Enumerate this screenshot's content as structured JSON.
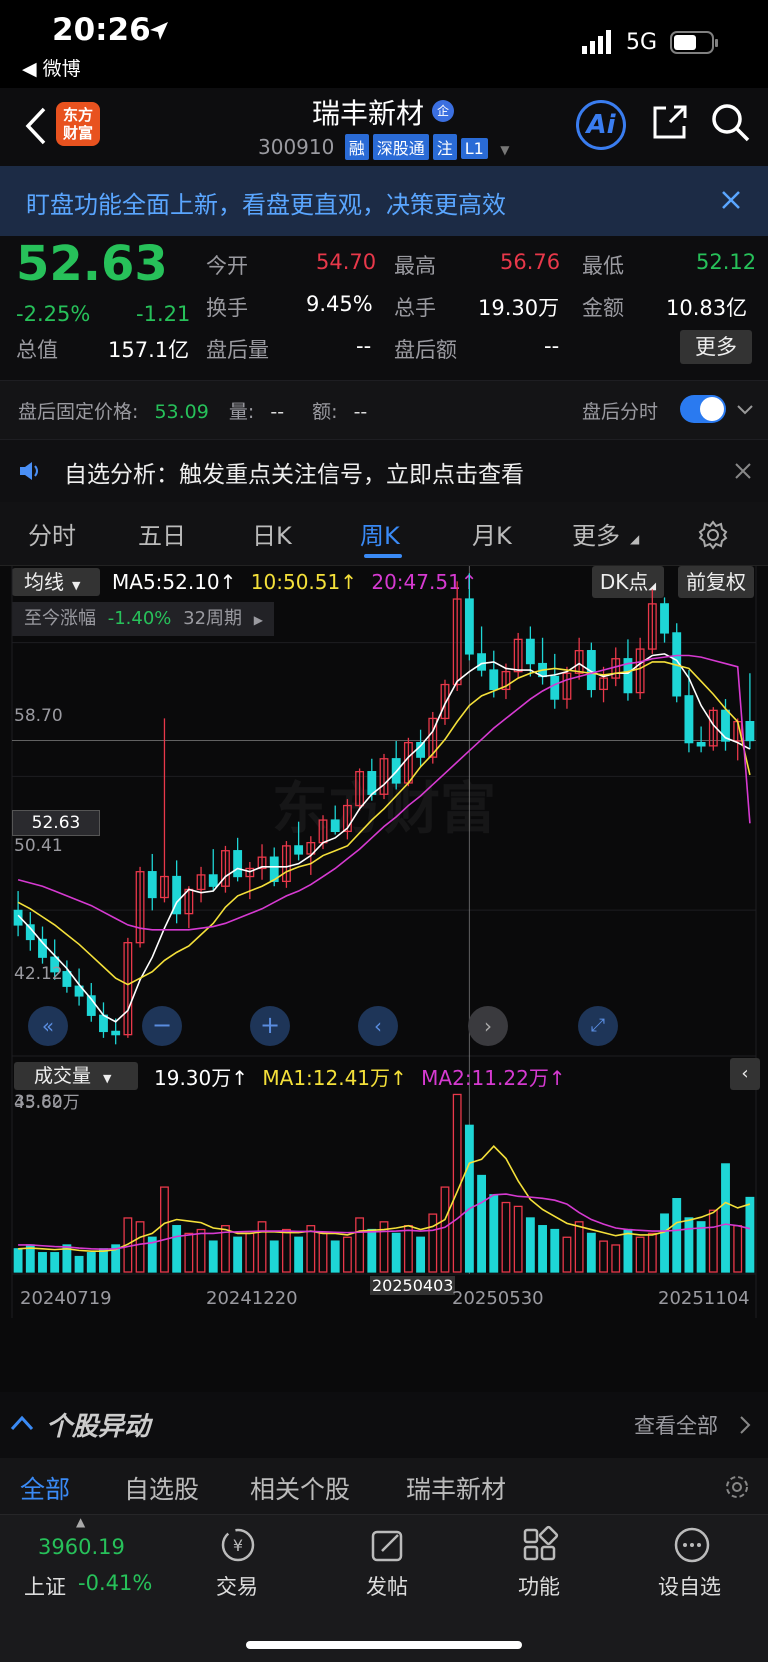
{
  "status_bar": {
    "time": "20:26",
    "back_app": "◀ 微博",
    "network": "5G"
  },
  "nav": {
    "stock_name": "瑞丰新材",
    "code": "300910",
    "badges": [
      "融",
      "深股通",
      "注",
      "L1"
    ],
    "logo_line1": "东方",
    "logo_line2": "财富",
    "ai_label": "Ai"
  },
  "banner": {
    "text": "盯盘功能全面上新，看盘更直观，决策更高效"
  },
  "quote": {
    "price": "52.63",
    "change_pct": "-2.25%",
    "change": "-1.21",
    "open_label": "今开",
    "open": "54.70",
    "high_label": "最高",
    "high": "56.76",
    "low_label": "最低",
    "low": "52.12",
    "turnover_label": "换手",
    "turnover": "9.45%",
    "volume_label": "总手",
    "volume": "19.30万",
    "amount_label": "金额",
    "amount": "10.83亿",
    "mktcap_label": "总值",
    "mktcap": "157.1亿",
    "after_vol_label": "盘后量",
    "after_vol": "--",
    "after_amt_label": "盘后额",
    "after_amt": "--",
    "more": "更多"
  },
  "after_hours": {
    "label": "盘后固定价格:",
    "price": "53.09",
    "vol_label": "量:",
    "vol": "--",
    "amt_label": "额:",
    "amt": "--",
    "toggle_label": "盘后分时"
  },
  "notice": {
    "text": "自选分析：触发重点关注信号，立即点击查看"
  },
  "tabs": [
    {
      "label": "分时"
    },
    {
      "label": "五日"
    },
    {
      "label": "日K"
    },
    {
      "label": "周K",
      "active": true
    },
    {
      "label": "月K"
    },
    {
      "label": "更多"
    }
  ],
  "chart_header": {
    "ma_select": "均线",
    "ma5": "MA5:52.10↑",
    "ma10": "10:50.51↑",
    "ma20": "20:47.51↑",
    "dk": "DK点",
    "adjust": "前复权",
    "period_label": "至今涨幅",
    "period_pct": "-1.40%",
    "period_weeks": "32周期"
  },
  "price_axis": {
    "p1": "58.70",
    "p2": "50.41",
    "p3": "42.12",
    "p4": "33.82",
    "current": "52.63"
  },
  "volume_header": {
    "select": "成交量",
    "vol": "19.30万↑",
    "ma1": "MA1:12.41万↑",
    "ma2": "MA2:11.22万↑",
    "max": "45.60万"
  },
  "dates": [
    "20240719",
    "20241220",
    "20250403",
    "20250530",
    "20251104"
  ],
  "chart_data": {
    "type": "candlestick",
    "title": "瑞丰新材 周K",
    "ylim": [
      33.82,
      62.5
    ],
    "candles_note": "weekly candles, colors red=up, cyan=down",
    "candles": [
      [
        42.1,
        43.3,
        40.5,
        41.2
      ],
      [
        41.2,
        42.0,
        39.6,
        40.3
      ],
      [
        40.3,
        41.1,
        38.8,
        39.2
      ],
      [
        39.2,
        40.3,
        37.8,
        38.3
      ],
      [
        38.3,
        39.0,
        37.0,
        37.4
      ],
      [
        37.4,
        38.5,
        36.2,
        36.8
      ],
      [
        36.8,
        37.6,
        35.2,
        35.6
      ],
      [
        35.6,
        36.4,
        34.2,
        34.6
      ],
      [
        34.6,
        35.4,
        33.8,
        34.4
      ],
      [
        34.4,
        40.4,
        34.2,
        40.1
      ],
      [
        40.1,
        44.8,
        39.8,
        44.5
      ],
      [
        44.5,
        45.6,
        42.1,
        42.9
      ],
      [
        42.9,
        54.0,
        42.6,
        44.2
      ],
      [
        44.2,
        45.2,
        41.3,
        41.9
      ],
      [
        41.9,
        43.6,
        41.0,
        43.4
      ],
      [
        43.4,
        44.8,
        42.6,
        44.3
      ],
      [
        44.3,
        45.9,
        43.3,
        43.6
      ],
      [
        43.6,
        46.1,
        43.2,
        45.8
      ],
      [
        45.8,
        46.6,
        43.9,
        44.2
      ],
      [
        44.2,
        45.1,
        42.8,
        44.7
      ],
      [
        44.7,
        46.2,
        44.0,
        45.4
      ],
      [
        45.4,
        46.0,
        43.6,
        43.9
      ],
      [
        43.9,
        46.4,
        43.5,
        46.1
      ],
      [
        46.1,
        47.6,
        45.2,
        45.6
      ],
      [
        45.6,
        46.7,
        44.3,
        46.3
      ],
      [
        46.3,
        48.0,
        45.9,
        47.7
      ],
      [
        47.7,
        48.6,
        46.8,
        47.0
      ],
      [
        47.0,
        49.0,
        46.5,
        48.6
      ],
      [
        48.6,
        50.9,
        48.3,
        50.7
      ],
      [
        50.7,
        51.5,
        48.9,
        49.3
      ],
      [
        49.3,
        51.8,
        49.0,
        51.5
      ],
      [
        51.5,
        52.6,
        49.6,
        50.0
      ],
      [
        50.0,
        52.8,
        49.8,
        52.5
      ],
      [
        52.5,
        53.3,
        51.0,
        51.6
      ],
      [
        51.6,
        54.4,
        51.2,
        54.0
      ],
      [
        54.0,
        56.4,
        53.6,
        56.1
      ],
      [
        56.1,
        62.5,
        55.7,
        61.4
      ],
      [
        61.4,
        63.0,
        57.6,
        58.0
      ],
      [
        58.0,
        59.7,
        56.6,
        57.0
      ],
      [
        57.0,
        58.2,
        55.3,
        55.8
      ],
      [
        55.8,
        57.4,
        55.2,
        56.9
      ],
      [
        56.9,
        59.3,
        56.5,
        58.9
      ],
      [
        58.9,
        59.7,
        56.6,
        57.4
      ],
      [
        57.4,
        59.0,
        56.1,
        56.6
      ],
      [
        56.6,
        58.0,
        54.6,
        55.2
      ],
      [
        55.2,
        57.2,
        54.6,
        56.8
      ],
      [
        56.8,
        59.0,
        56.4,
        58.2
      ],
      [
        58.2,
        58.7,
        55.3,
        55.8
      ],
      [
        55.8,
        57.2,
        55.0,
        56.5
      ],
      [
        56.5,
        58.4,
        56.0,
        57.7
      ],
      [
        57.7,
        58.9,
        55.1,
        55.6
      ],
      [
        55.6,
        59.0,
        55.2,
        58.3
      ],
      [
        58.3,
        62.0,
        58.0,
        61.1
      ],
      [
        61.1,
        61.5,
        58.7,
        59.3
      ],
      [
        59.3,
        59.9,
        55.0,
        55.4
      ],
      [
        55.4,
        57.0,
        51.9,
        52.5
      ],
      [
        52.5,
        53.5,
        51.9,
        52.3
      ],
      [
        52.3,
        54.7,
        52.0,
        54.5
      ],
      [
        54.5,
        55.2,
        52.0,
        52.6
      ],
      [
        52.6,
        54.0,
        51.4,
        53.8
      ],
      [
        53.8,
        56.8,
        52.1,
        52.63
      ]
    ],
    "series": [
      {
        "name": "MA5",
        "values": [
          41.8,
          41.0,
          40.1,
          39.3,
          38.5,
          37.5,
          36.6,
          35.6,
          35.2,
          35.9,
          37.8,
          39.2,
          41.0,
          42.6,
          43.4,
          43.2,
          43.3,
          44.2,
          44.7,
          44.5,
          44.8,
          44.8,
          44.8,
          45.0,
          45.5,
          46.3,
          46.6,
          47.2,
          48.4,
          49.3,
          49.9,
          50.7,
          51.6,
          52.3,
          53.2,
          54.9,
          56.3,
          56.9,
          57.4,
          57.5,
          57.1,
          57.0,
          57.0,
          56.6,
          56.7,
          56.9,
          57.4,
          56.9,
          56.6,
          56.8,
          56.8,
          57.4,
          57.9,
          58.0,
          57.6,
          56.5,
          54.8,
          53.6,
          52.8,
          52.5,
          52.1
        ]
      },
      {
        "name": "MA10",
        "values": [
          42.6,
          42.2,
          41.7,
          41.2,
          40.6,
          40.0,
          39.3,
          38.6,
          37.9,
          37.5,
          37.9,
          38.3,
          39.0,
          39.5,
          39.9,
          40.6,
          41.3,
          42.3,
          43.0,
          43.3,
          43.6,
          44.0,
          44.5,
          44.8,
          45.0,
          45.5,
          45.8,
          46.1,
          46.9,
          47.7,
          48.4,
          49.2,
          50.0,
          51.0,
          51.8,
          52.7,
          53.8,
          54.8,
          55.4,
          55.7,
          56.0,
          56.5,
          56.8,
          57.0,
          57.1,
          57.0,
          56.9,
          56.8,
          56.7,
          56.8,
          56.9,
          57.1,
          57.5,
          57.5,
          57.3,
          57.1,
          56.3,
          55.5,
          54.6,
          53.8,
          50.5
        ]
      },
      {
        "name": "MA20",
        "values": [
          44.0,
          43.8,
          43.6,
          43.3,
          43.0,
          42.7,
          42.4,
          42.0,
          41.6,
          41.2,
          41.0,
          40.9,
          40.9,
          40.9,
          40.9,
          41.0,
          41.1,
          41.3,
          41.6,
          41.9,
          42.2,
          42.6,
          43.0,
          43.3,
          43.7,
          44.2,
          44.7,
          45.3,
          45.9,
          46.6,
          47.3,
          47.9,
          48.6,
          49.2,
          49.9,
          50.6,
          51.3,
          52.0,
          52.7,
          53.4,
          54.0,
          54.6,
          55.2,
          55.7,
          56.1,
          56.4,
          56.6,
          56.8,
          57.0,
          57.2,
          57.4,
          57.5,
          57.7,
          57.8,
          57.9,
          57.9,
          57.8,
          57.6,
          57.4,
          57.2,
          47.5
        ]
      }
    ],
    "volume": [
      6,
      7,
      5,
      5,
      7,
      4,
      5,
      6,
      7,
      14,
      13,
      9,
      22,
      12,
      10,
      11,
      8,
      12,
      9,
      10,
      13,
      8,
      11,
      9,
      12,
      10,
      8,
      9,
      14,
      11,
      13,
      10,
      12,
      9,
      15,
      22,
      46,
      38,
      25,
      20,
      18,
      17,
      14,
      12,
      11,
      9,
      13,
      10,
      8,
      7,
      11,
      9,
      10,
      15,
      19,
      14,
      13,
      16,
      28,
      12,
      19.3
    ],
    "volume_ma1": [
      6,
      6.2,
      6.0,
      5.8,
      6.0,
      5.6,
      5.4,
      5.4,
      5.8,
      7.2,
      9.0,
      10.0,
      12.6,
      13.6,
      13.2,
      12.8,
      11.4,
      11.0,
      10.0,
      10.0,
      10.4,
      10.4,
      10.2,
      10.2,
      10.6,
      10.0,
      10.0,
      9.6,
      10.6,
      10.8,
      11.0,
      11.4,
      12.0,
      11.0,
      11.8,
      13.6,
      20.8,
      28.2,
      29.2,
      32.6,
      29.4,
      23.6,
      18.8,
      16.2,
      14.4,
      12.6,
      11.8,
      11.0,
      10.2,
      9.4,
      10.0,
      9.6,
      9.6,
      10.4,
      12.8,
      13.4,
      14.2,
      15.4,
      18.0,
      16.6,
      17.6
    ],
    "volume_ma2": [
      7,
      7,
      6.8,
      6.6,
      6.5,
      6.2,
      6.0,
      5.9,
      6.0,
      6.6,
      7.2,
      7.6,
      8.4,
      9.2,
      9.6,
      10.0,
      10.0,
      10.3,
      10.4,
      10.5,
      10.6,
      10.6,
      10.6,
      10.5,
      10.5,
      10.4,
      10.3,
      10.2,
      10.3,
      10.4,
      10.5,
      10.6,
      10.8,
      10.6,
      10.8,
      11.6,
      13.8,
      16.4,
      18.0,
      20.0,
      20.2,
      19.6,
      19.4,
      19.1,
      18.6,
      17.6,
      15.4,
      13.6,
      12.4,
      11.4,
      11.0,
      10.8,
      10.6,
      10.6,
      10.8,
      11.2,
      11.4,
      11.6,
      12.4,
      12.0,
      11.22
    ],
    "ylabel": "",
    "xlabel": ""
  },
  "movement": {
    "title": "个股异动",
    "view_all": "查看全部"
  },
  "bottom_tabs": [
    {
      "label": "全部",
      "active": true
    },
    {
      "label": "自选股"
    },
    {
      "label": "相关个股"
    },
    {
      "label": "瑞丰新材"
    }
  ],
  "dock": {
    "index_value": "3960.19",
    "index_name": "上证",
    "index_change": "-0.41%",
    "items": [
      {
        "label": "交易"
      },
      {
        "label": "发帖"
      },
      {
        "label": "功能"
      },
      {
        "label": "设自选"
      }
    ]
  },
  "colors": {
    "up": "#e8384a",
    "down": "#1ed6d6",
    "ma5": "#ffffff",
    "ma10": "#f4e03a",
    "ma20": "#d63ad1",
    "accent": "#2a6bd6"
  }
}
